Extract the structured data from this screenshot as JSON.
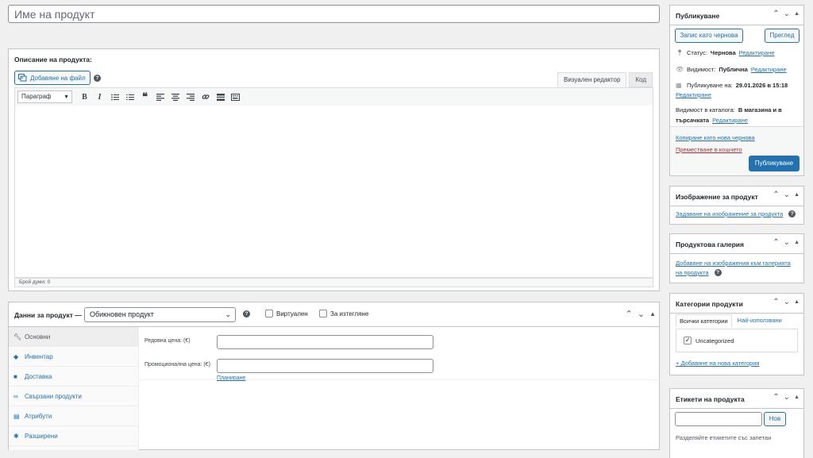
{
  "title_placeholder": "Име на продукт",
  "description": {
    "heading": "Описание на продукта:",
    "add_media": "Добавяне на файл",
    "tab_visual": "Визуален редактор",
    "tab_code": "Код",
    "format_select": "Параграф",
    "word_count": "Брой думи: 0"
  },
  "product_data": {
    "label": "Данни за продукт —",
    "type_value": "Обикновен продукт",
    "virtual_label": "Виртуален",
    "downloadable_label": "За изтегляне",
    "tabs": [
      {
        "label": "Основни",
        "icon": "wrench-icon"
      },
      {
        "label": "Инвентар",
        "icon": "tag-icon"
      },
      {
        "label": "Доставка",
        "icon": "truck-icon"
      },
      {
        "label": "Свързани продукти",
        "icon": "link-icon"
      },
      {
        "label": "Атрибути",
        "icon": "table-icon"
      },
      {
        "label": "Разширени",
        "icon": "gear-icon"
      }
    ],
    "regular_price_label": "Редовна цена: (€)",
    "sale_price_label": "Промоционална цена: (€)",
    "schedule_link": "Планиране"
  },
  "publish": {
    "title": "Публикуване",
    "save_draft": "Запис като чернова",
    "preview": "Преглед",
    "status_label": "Статус:",
    "status_value": "Чернова",
    "visibility_label": "Видимост:",
    "visibility_value": "Публична",
    "publish_label": "Публикуване на:",
    "publish_value": "29.01.2026 в 15:18",
    "edit": "Редактиране",
    "catalog_label": "Видимост в каталога:",
    "catalog_value_1": "В магазина и в",
    "catalog_value_2": "търсачката",
    "copy_draft": "Копиране като нова чернова",
    "trash": "Преместване в кошчето",
    "publish_button": "Публикуване"
  },
  "product_image": {
    "title": "Изображение за продукт",
    "set_link": "Задаване на изображение за продукта"
  },
  "gallery": {
    "title": "Продуктова галерия",
    "add_link_1": "Добавяне на изображения към галерията",
    "add_link_2": "на продукта"
  },
  "categories": {
    "title": "Категории продукти",
    "tab_all": "Всички категории",
    "tab_popular": "Най-използвани",
    "item": "Uncategorized",
    "add_new": "+ Добавяне на нова категория"
  },
  "tags": {
    "title": "Етикети на продукта",
    "add_button": "Нов",
    "hint": "Разделяйте етикетите със запетаи"
  },
  "colors": {
    "accent": "#2271b1",
    "trash": "#b32d2e",
    "background": "#f0f0f1"
  }
}
